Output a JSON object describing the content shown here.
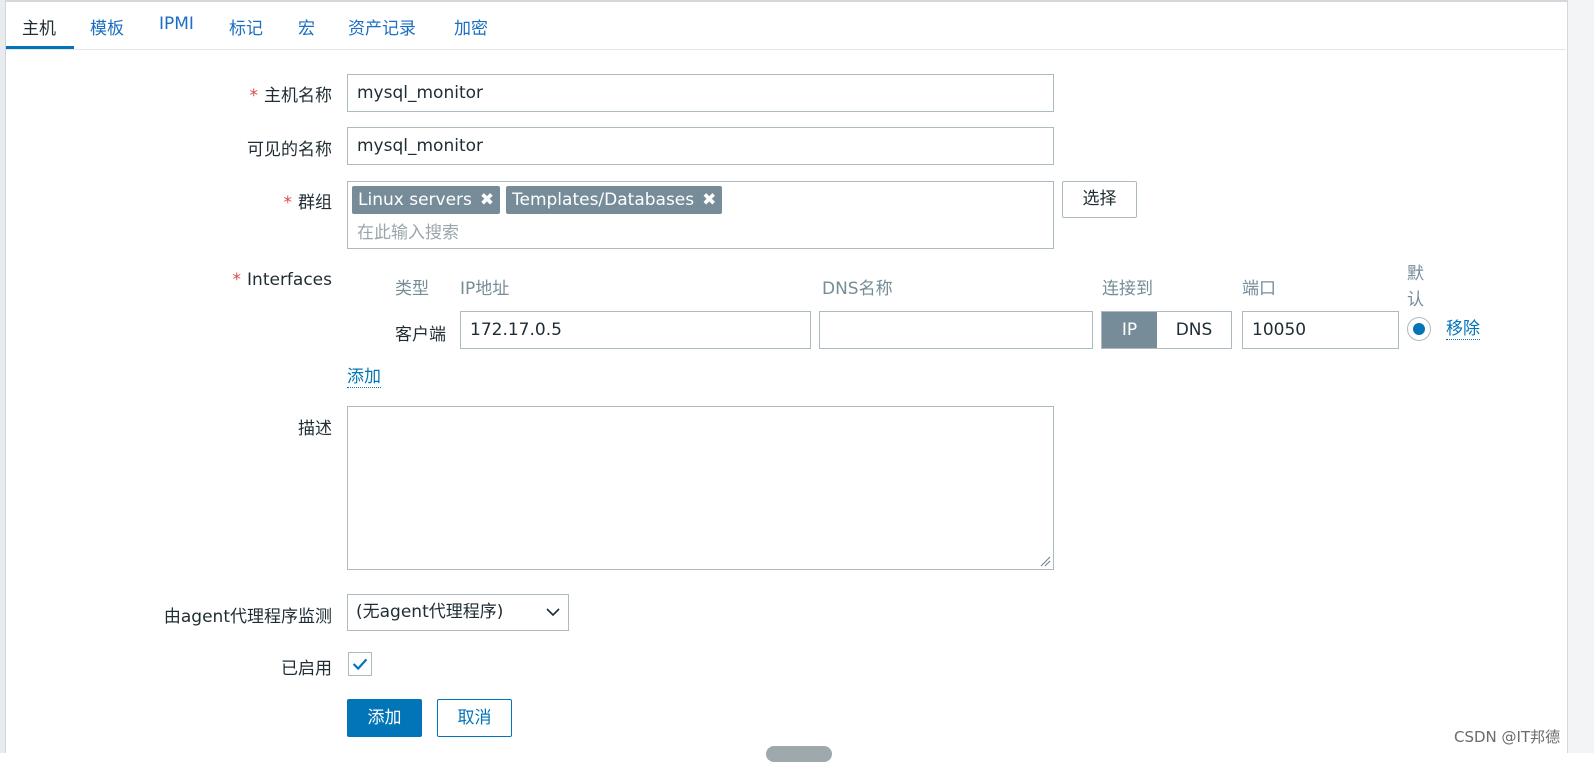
{
  "tabs": [
    {
      "label": "主机",
      "active": true
    },
    {
      "label": "模板"
    },
    {
      "label": "IPMI"
    },
    {
      "label": "标记"
    },
    {
      "label": "宏"
    },
    {
      "label": "资产记录"
    },
    {
      "label": "加密"
    }
  ],
  "form": {
    "required_mark": "*",
    "host_name": {
      "label": "主机名称",
      "value": "mysql_monitor"
    },
    "visible_name": {
      "label": "可见的名称",
      "value": "mysql_monitor"
    },
    "groups": {
      "label": "群组",
      "chips": [
        "Linux servers",
        "Templates/Databases"
      ],
      "placeholder": "在此输入搜索",
      "select_button": "选择"
    },
    "interfaces": {
      "label": "Interfaces",
      "headers": {
        "type": "类型",
        "ip": "IP地址",
        "dns": "DNS名称",
        "connect_to": "连接到",
        "port": "端口",
        "default_line1": "默",
        "default_line2": "认"
      },
      "row": {
        "type": "客户端",
        "ip": "172.17.0.5",
        "dns": "",
        "connect_ip": "IP",
        "connect_dns": "DNS",
        "connect_selected": "IP",
        "port": "10050",
        "default_selected": true,
        "remove": "移除"
      },
      "add_link": "添加"
    },
    "description": {
      "label": "描述",
      "value": ""
    },
    "monitored_by": {
      "label": "由agent代理程序监测",
      "selected": "(无agent代理程序)"
    },
    "enabled": {
      "label": "已启用",
      "checked": true
    },
    "buttons": {
      "add": "添加",
      "cancel": "取消"
    }
  },
  "colors": {
    "accent": "#0275b8",
    "chip": "#768d99",
    "required": "#e0474c",
    "link": "#0275b8"
  },
  "watermark": "CSDN @IT邦德"
}
